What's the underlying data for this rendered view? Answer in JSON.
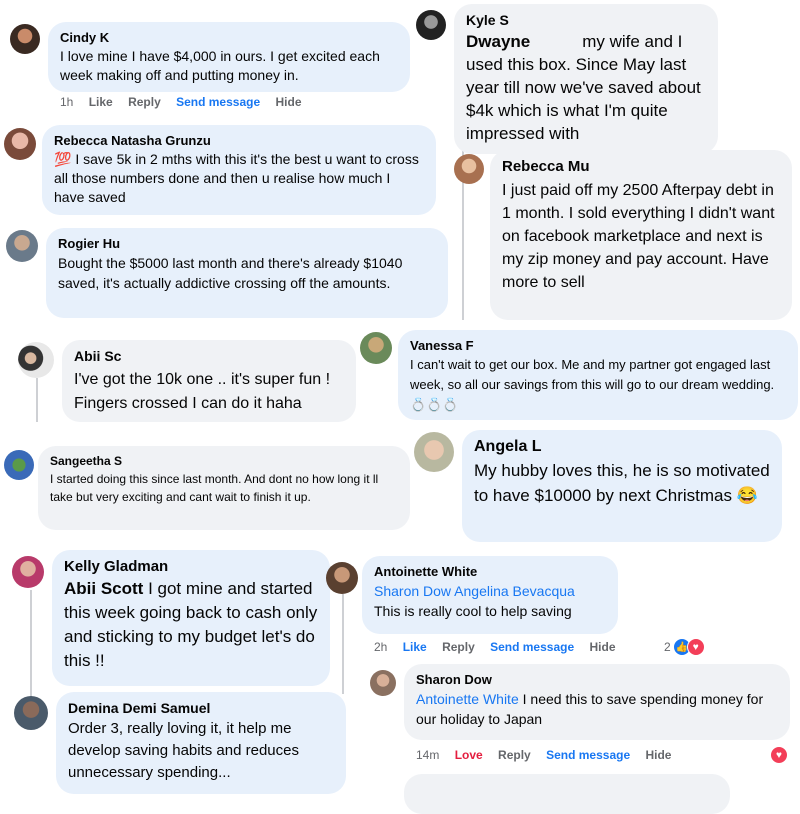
{
  "comments": [
    {
      "name": "Cindy K",
      "body": "I love mine I have $4,000 in ours. I get excited each week making off and putting money in."
    },
    {
      "name": "Rebecca Natasha Grunzu",
      "emoji": "💯",
      "body": "I save 5k in 2 mths with this it's the best u want to cross all those numbers done and then u realise how much I have saved"
    },
    {
      "name": "Rogier Hu",
      "body": "Bought the $5000 last month and there's already $1040 saved, it's actually addictive crossing off the amounts."
    },
    {
      "name": "Abii Sc",
      "body": "I've got the 10k one .. it's super fun ! Fingers crossed I can do it haha"
    },
    {
      "name": "Sangeetha S",
      "body": "I started doing this since last month. And dont no how long it ll take but very exciting and cant wait to finish it up."
    },
    {
      "name": "Kelly Gladman",
      "mention": "Abii Scott",
      "body": "I got mine and started this week going back to cash only and sticking to my budget let's do this !!"
    },
    {
      "name": "Demina Demi Samuel",
      "body": "Order 3, really loving it, it help me develop saving habits and reduces unnecessary spending..."
    },
    {
      "name": "Kyle S",
      "mention": "Dwayne",
      "body": "my wife and I used this box. Since May last year till now we've saved about $4k which is what I'm quite impressed with"
    },
    {
      "name": "Rebecca Mu",
      "body": "I just paid off my 2500 Afterpay debt in 1 month. I sold everything I didn't want on facebook marketplace and next is my zip money and pay account. Have more to sell"
    },
    {
      "name": "Vanessa F",
      "body": "I can't wait to get our box. Me and my partner got engaged last week, so all our savings from this will go to our dream wedding.",
      "emoji_trail": "💍💍💍"
    },
    {
      "name": "Angela L",
      "body": "My hubby loves this, he is so motivated to have $10000 by next Christmas",
      "emoji_trail": "😂"
    },
    {
      "name": "Antoinette White",
      "mention": "Sharon Dow Angelina Bevacqua",
      "body": "This is really cool to help saving"
    },
    {
      "name": "Sharon Dow",
      "mention": "Antoinette White",
      "body": "I need this to save spending money for our holiday to Japan"
    }
  ],
  "actions": {
    "cindy": {
      "time": "1h",
      "like": "Like",
      "reply": "Reply",
      "send": "Send message",
      "hide": "Hide"
    },
    "antoinette": {
      "time": "2h",
      "like": "Like",
      "reply": "Reply",
      "send": "Send message",
      "hide": "Hide",
      "reaction_count": "2"
    },
    "sharon": {
      "time": "14m",
      "love": "Love",
      "reply": "Reply",
      "send": "Send message",
      "hide": "Hide"
    }
  },
  "colors": {
    "link": "#1877f2",
    "love": "#e41e3f",
    "bubble": "#f0f2f5",
    "bubble_blue": "#e7f0fb"
  }
}
